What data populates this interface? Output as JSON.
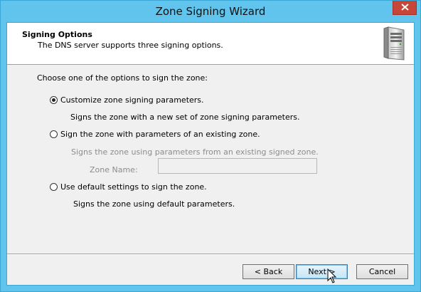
{
  "window": {
    "title": "Zone Signing Wizard"
  },
  "header": {
    "title": "Signing Options",
    "subtitle": "The DNS server supports three signing options."
  },
  "content": {
    "prompt": "Choose one of the options to sign the zone:",
    "options": [
      {
        "label": "Customize zone signing parameters.",
        "description": "Signs the zone with a new set of zone signing parameters.",
        "checked": true,
        "enabled": true
      },
      {
        "label": "Sign the zone with parameters of an existing zone.",
        "description": "Signs the zone using parameters from an existing signed zone.",
        "checked": false,
        "enabled": true
      },
      {
        "label": "Use default settings to sign the zone.",
        "description": "Signs the zone using default parameters.",
        "checked": false,
        "enabled": true
      }
    ],
    "zone_name_label": "Zone Name:",
    "zone_name_value": ""
  },
  "buttons": {
    "back": "< Back",
    "next": "Next >",
    "cancel": "Cancel"
  },
  "icons": {
    "header_icon": "server-icon",
    "close_icon": "close-icon",
    "cursor": "pointer-cursor"
  },
  "colors": {
    "title_bar": "#60c4ec",
    "close_button": "#c7463a",
    "default_button": "#c4e5f6"
  }
}
